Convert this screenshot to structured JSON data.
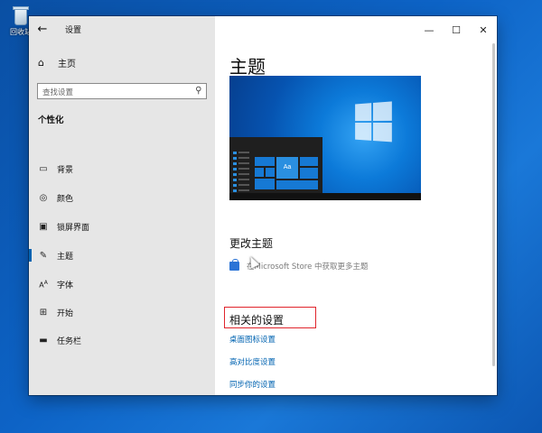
{
  "desktop": {
    "recycle_bin_label": "回收站"
  },
  "window": {
    "title": "设置",
    "controls": {
      "minimize": "—",
      "maximize": "☐",
      "close": "✕"
    }
  },
  "sidebar": {
    "home_label": "主页",
    "search_placeholder": "查找设置",
    "section_title": "个性化",
    "items": [
      {
        "label": "背景",
        "icon": "picture-icon"
      },
      {
        "label": "颜色",
        "icon": "palette-icon"
      },
      {
        "label": "锁屏界面",
        "icon": "lock-screen-icon"
      },
      {
        "label": "主题",
        "icon": "brush-icon",
        "active": true
      },
      {
        "label": "字体",
        "icon": "font-icon"
      },
      {
        "label": "开始",
        "icon": "start-icon"
      },
      {
        "label": "任务栏",
        "icon": "taskbar-icon"
      }
    ]
  },
  "main": {
    "title": "主题",
    "preview_tile_text": "Aa",
    "change_theme_heading": "更改主题",
    "store_link": "在Microsoft Store 中获取更多主题",
    "related_heading": "相关的设置",
    "related_links": [
      "桌面图标设置",
      "高对比度设置",
      "同步你的设置"
    ]
  },
  "colors": {
    "accent": "#0063b1",
    "highlight_box": "#e0242c"
  }
}
